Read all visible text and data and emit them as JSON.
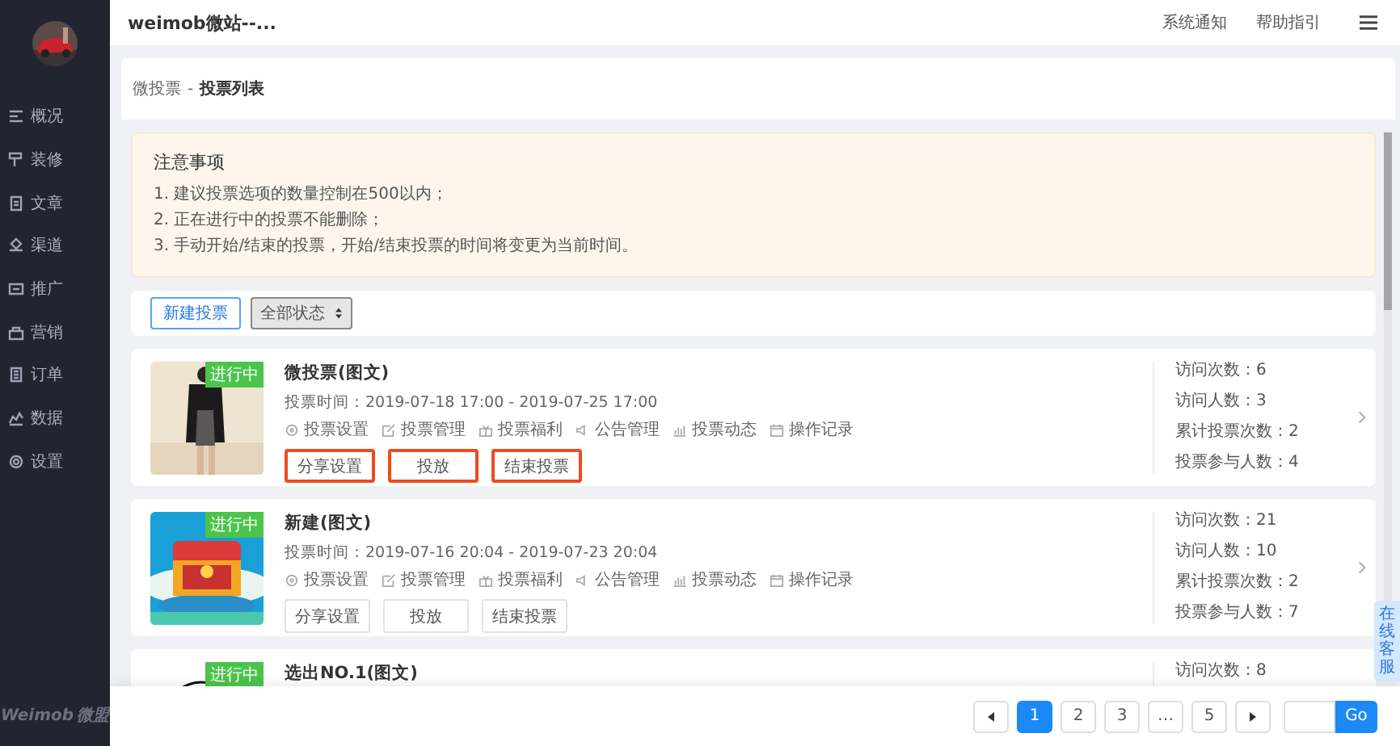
{
  "header": {
    "title": "weimob微站--...",
    "links": [
      "系统通知",
      "帮助指引"
    ]
  },
  "sidebar": {
    "items": [
      {
        "label": "概况"
      },
      {
        "label": "装修"
      },
      {
        "label": "文章"
      },
      {
        "label": "渠道"
      },
      {
        "label": "推广"
      },
      {
        "label": "营销"
      },
      {
        "label": "订单"
      },
      {
        "label": "数据"
      },
      {
        "label": "设置"
      }
    ],
    "brand": "Weimob",
    "brand_cn": "微盟"
  },
  "breadcrumb": {
    "parent": "微投票",
    "separator": "-",
    "current": "投票列表"
  },
  "notice": {
    "title": "注意事项",
    "lines": [
      "1. 建议投票选项的数量控制在500以内；",
      "2. 正在进行中的投票不能删除；",
      "3. 手动开始/结束的投票，开始/结束投票的时间将变更为当前时间。"
    ]
  },
  "toolbar": {
    "create_button": "新建投票",
    "filter": "全部状态"
  },
  "votes": [
    {
      "title": "微投票(图文)",
      "status": "进行中",
      "time": "投票时间：2019-07-18 17:00 - 2019-07-25 17:00",
      "actions": [
        "投票设置",
        "投票管理",
        "投票福利",
        "公告管理",
        "投票动态",
        "操作记录"
      ],
      "buttons": [
        {
          "label": "分享设置",
          "highlighted": true
        },
        {
          "label": "投放",
          "highlighted": true
        },
        {
          "label": "结束投票",
          "highlighted": true
        }
      ],
      "stats": [
        "访问次数：6",
        "访问人数：3",
        "累计投票次数：2",
        "投票参与人数：4"
      ]
    },
    {
      "title": "新建(图文)",
      "status": "进行中",
      "time": "投票时间：2019-07-16 20:04 - 2019-07-23 20:04",
      "actions": [
        "投票设置",
        "投票管理",
        "投票福利",
        "公告管理",
        "投票动态",
        "操作记录"
      ],
      "buttons": [
        {
          "label": "分享设置",
          "highlighted": false
        },
        {
          "label": "投放",
          "highlighted": false
        },
        {
          "label": "结束投票",
          "highlighted": false
        }
      ],
      "stats": [
        "访问次数：21",
        "访问人数：10",
        "累计投票次数：2",
        "投票参与人数：7"
      ]
    },
    {
      "title": "选出NO.1(图文)",
      "status": "进行中",
      "stats": [
        "访问次数：8"
      ]
    }
  ],
  "pagination": {
    "pages": [
      {
        "label": "1",
        "selected": true
      },
      {
        "label": "2",
        "selected": false
      },
      {
        "label": "3",
        "selected": false
      },
      {
        "label": "…",
        "selected": false
      },
      {
        "label": "5",
        "selected": false
      }
    ],
    "go": "Go"
  },
  "service_tab": "在线客服"
}
